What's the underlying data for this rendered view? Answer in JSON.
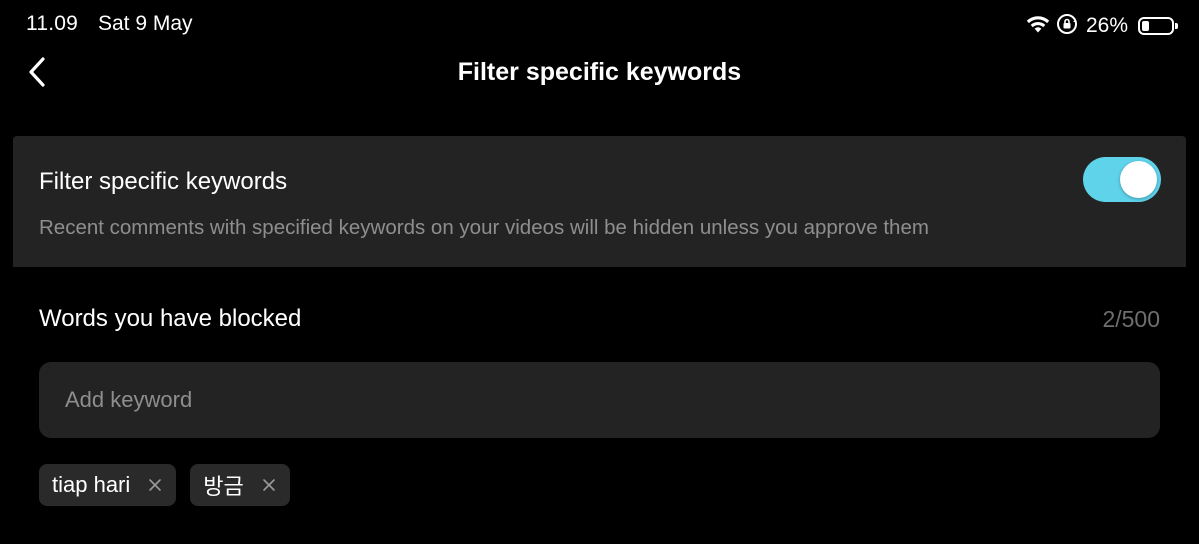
{
  "status_bar": {
    "time": "11.09",
    "date": "Sat 9 May",
    "battery_percent": "26%",
    "battery_level": 0.26
  },
  "nav": {
    "title": "Filter specific keywords",
    "back_icon": "chevron-left-icon"
  },
  "filter_setting": {
    "title": "Filter specific keywords",
    "description": "Recent comments with specified keywords on your videos will be hidden unless you approve them",
    "enabled": true,
    "toggle_color": "#5ed3ea"
  },
  "blocked_words": {
    "heading": "Words you have blocked",
    "count": "2/500",
    "input_placeholder": "Add keyword",
    "input_value": "",
    "keywords": [
      {
        "label": "tiap hari"
      },
      {
        "label": "방금"
      }
    ]
  }
}
